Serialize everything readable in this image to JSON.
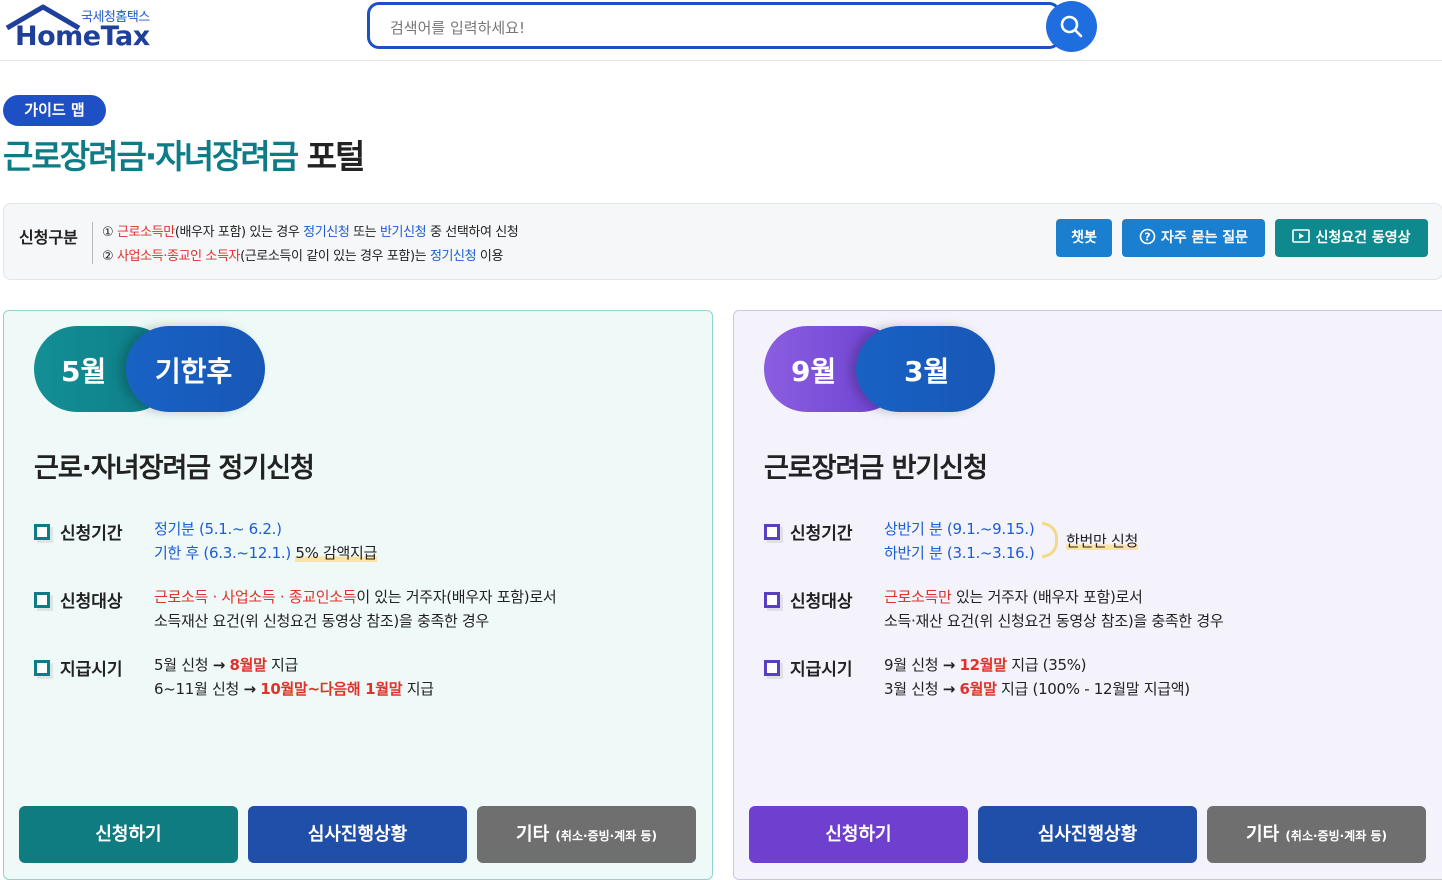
{
  "header": {
    "logo_sub": "국세청홈택스",
    "logo_main": "HomeTax",
    "search_placeholder": "검색어를 입력하세요!"
  },
  "guide_pill": "가이드 맵",
  "title": {
    "teal": "근로장려금·자녀장려금",
    "dark": "포털"
  },
  "notice": {
    "label": "신청구분",
    "line1": {
      "num": "①",
      "red": "근로소득만",
      "t1": "(배우자 포함) 있는 경우 ",
      "blue1": "정기신청",
      "t2": " 또는 ",
      "blue2": "반기신청",
      "t3": " 중 선택하여 신청"
    },
    "line2": {
      "num": "②",
      "red": "사업소득·종교인 소득자",
      "t1": "(근로소득이 같이 있는 경우 포함)는 ",
      "blue1": "정기신청",
      "t2": " 이용"
    },
    "buttons": {
      "chatbot": "챗봇",
      "faq": "자주 묻는 질문",
      "video": "신청요건 동영상"
    }
  },
  "left_card": {
    "pill_a": "5월",
    "pill_b": "기한후",
    "title": "근로·자녀장려금 정기신청",
    "period_label": "신청기간",
    "period1": "정기분 (5.1.~ 6.2.)",
    "period2": "기한 후 (6.3.~12.1.)",
    "period2_note": "5% 감액지급",
    "target_label": "신청대상",
    "target1_red": "근로소득 · 사업소득 · 종교인소득",
    "target1_rest": "이 있는 거주자(배우자 포함)로서",
    "target2": "소득재산 요건(위 신청요건 동영상 참조)을 충족한 경우",
    "pay_label": "지급시기",
    "pay1_a": "5월 신청",
    "pay1_red": "8월말",
    "pay1_b": "지급",
    "pay2_a": "6~11월 신청",
    "pay2_red": "10월말~다음해 1월말",
    "pay2_b": "지급",
    "arrow": "→",
    "btn_apply": "신청하기",
    "btn_status": "심사진행상황",
    "btn_etc": "기타",
    "btn_etc_small": "(취소·증빙·계좌 등)"
  },
  "right_card": {
    "pill_a": "9월",
    "pill_b": "3월",
    "title": "근로장려금 반기신청",
    "period_label": "신청기간",
    "period1": "상반기 분 (9.1.~9.15.)",
    "period2": "하반기 분 (3.1.~3.16.)",
    "period_note": "한번만 신청",
    "target_label": "신청대상",
    "target1_red": "근로소득만",
    "target1_rest": " 있는 거주자 (배우자 포함)로서",
    "target2": "소득·재산 요건(위 신청요건 동영상 참조)을 충족한 경우",
    "pay_label": "지급시기",
    "pay1_a": "9월 신청",
    "pay1_red": "12월말",
    "pay1_b": "지급 (35%)",
    "pay2_a": "3월 신청",
    "pay2_red": "6월말",
    "pay2_b": "지급 (100% - 12월말 지급액)",
    "arrow": "→",
    "btn_apply": "신청하기",
    "btn_status": "심사진행상황",
    "btn_etc": "기타",
    "btn_etc_small": "(취소·증빙·계좌 등)"
  }
}
